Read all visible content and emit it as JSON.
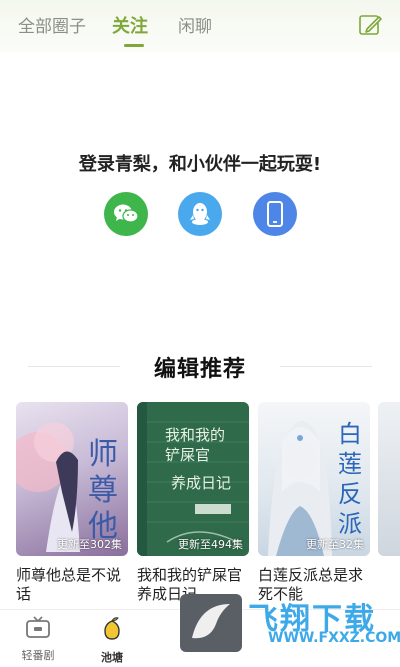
{
  "top_tabs": {
    "all_circles": "全部圈子",
    "following": "关注",
    "chat": "闲聊"
  },
  "login": {
    "prompt": "登录青梨，和小伙伴一起玩耍!",
    "methods": [
      "wechat",
      "qq",
      "phone"
    ]
  },
  "editor_picks": {
    "heading": "编辑推荐",
    "books": [
      {
        "title": "师尊他总是不说话",
        "status": "更新至302集",
        "cover_text": "师尊他"
      },
      {
        "title": "我和我的铲屎官养成日记",
        "status": "更新至494集",
        "cover_text": "我和我的铲屎官养成日记"
      },
      {
        "title": "白莲反派总是求死不能",
        "status": "更新至32集",
        "cover_text": "白莲反派"
      },
      {
        "title": "",
        "status": "",
        "cover_text": ""
      }
    ]
  },
  "bottom_nav": {
    "items": [
      {
        "label": "轻番剧",
        "icon": "tv-icon"
      },
      {
        "label": "池塘",
        "icon": "pear-icon"
      }
    ]
  },
  "watermark": {
    "text": "飞翔下载",
    "url": "WWW.FXXZ.COM"
  },
  "colors": {
    "accent": "#7ea83a",
    "wechat": "#3fb64b",
    "qq": "#4aa8ec",
    "phone": "#4d86e6"
  }
}
